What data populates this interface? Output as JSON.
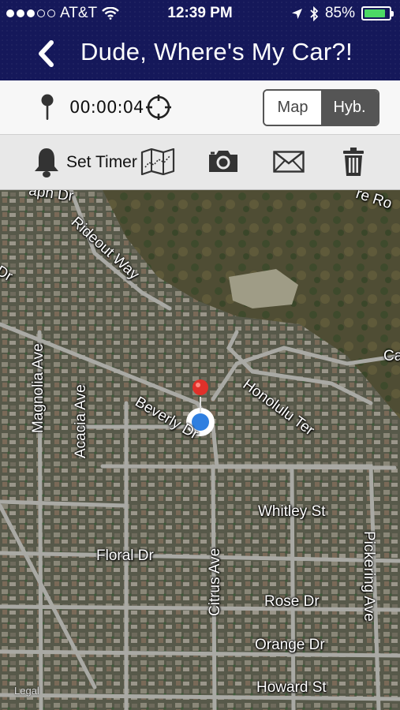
{
  "status_bar": {
    "carrier": "AT&T",
    "time": "12:39 PM",
    "battery_percent": "85%",
    "battery_level": 0.85,
    "signal_bars_filled": 3,
    "signal_bars_total": 5
  },
  "nav": {
    "title": "Dude, Where's My Car?!",
    "back_icon": "chevron-left-icon"
  },
  "timer_row": {
    "elapsed": "00:00:04",
    "map_type_options": [
      "Map",
      "Hyb."
    ],
    "selected_map_type": "Hyb."
  },
  "toolbar": {
    "set_timer_label": "Set Timer",
    "icons": [
      "bell-icon",
      "map-icon",
      "camera-icon",
      "mail-icon",
      "trash-icon"
    ]
  },
  "map": {
    "street_labels": {
      "rideout_way": "Rideout Way",
      "dr_top_left": "Dr",
      "caph_dr": "aph Dr",
      "re_ro": "re Ro",
      "ca": "Ca",
      "magnolia_ave": "Magnolia Ave",
      "acacia_ave": "Acacia Ave",
      "beverly_dr": "Beverly Dr",
      "honolulu_ter": "Honolulu Ter",
      "whitley_st": "Whitley St",
      "floral_dr": "Floral Dr",
      "citrus_ave": "Citrus Ave",
      "pickering_ave": "Pickering Ave",
      "rose_dr": "Rose Dr",
      "orange_dr": "Orange Dr",
      "howard_st": "Howard St"
    },
    "legal": "Legal",
    "colors": {
      "nav_background": "#15185a",
      "car_pin": "#e0302a",
      "user_location": "#2f7fe0",
      "battery_fill": "#4cd964"
    }
  }
}
